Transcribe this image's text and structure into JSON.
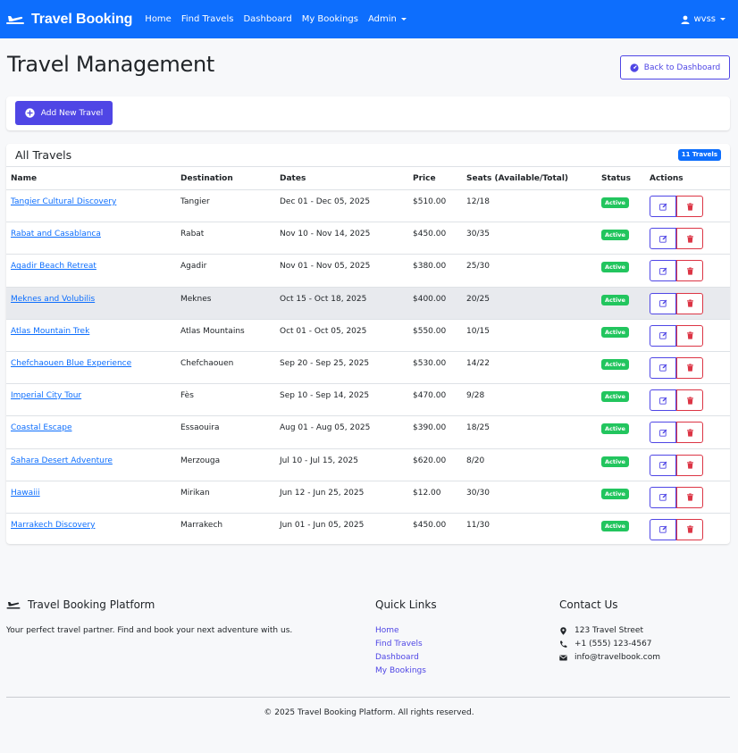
{
  "navbar": {
    "brand": "Travel Booking",
    "links": [
      "Home",
      "Find Travels",
      "Dashboard",
      "My Bookings"
    ],
    "admin_label": "Admin",
    "user": "wvss"
  },
  "header": {
    "title": "Travel Management",
    "back_label": "Back to Dashboard"
  },
  "actions": {
    "add_label": "Add New Travel"
  },
  "table": {
    "title": "All Travels",
    "count_badge": "11 Travels",
    "columns": [
      "Name",
      "Destination",
      "Dates",
      "Price",
      "Seats (Available/Total)",
      "Status",
      "Actions"
    ],
    "rows": [
      {
        "name": "Tangier Cultural Discovery",
        "destination": "Tangier",
        "dates": "Dec 01 - Dec 05, 2025",
        "price": "$510.00",
        "seats": "12/18",
        "status": "Active"
      },
      {
        "name": "Rabat and Casablanca",
        "destination": "Rabat",
        "dates": "Nov 10 - Nov 14, 2025",
        "price": "$450.00",
        "seats": "30/35",
        "status": "Active"
      },
      {
        "name": "Agadir Beach Retreat",
        "destination": "Agadir",
        "dates": "Nov 01 - Nov 05, 2025",
        "price": "$380.00",
        "seats": "25/30",
        "status": "Active"
      },
      {
        "name": "Meknes and Volubilis",
        "destination": "Meknes",
        "dates": "Oct 15 - Oct 18, 2025",
        "price": "$400.00",
        "seats": "20/25",
        "status": "Active"
      },
      {
        "name": "Atlas Mountain Trek",
        "destination": "Atlas Mountains",
        "dates": "Oct 01 - Oct 05, 2025",
        "price": "$550.00",
        "seats": "10/15",
        "status": "Active"
      },
      {
        "name": "Chefchaouen Blue Experience",
        "destination": "Chefchaouen",
        "dates": "Sep 20 - Sep 25, 2025",
        "price": "$530.00",
        "seats": "14/22",
        "status": "Active"
      },
      {
        "name": "Imperial City Tour",
        "destination": "Fès",
        "dates": "Sep 10 - Sep 14, 2025",
        "price": "$470.00",
        "seats": "9/28",
        "status": "Active"
      },
      {
        "name": "Coastal Escape",
        "destination": "Essaouira",
        "dates": "Aug 01 - Aug 05, 2025",
        "price": "$390.00",
        "seats": "18/25",
        "status": "Active"
      },
      {
        "name": "Sahara Desert Adventure",
        "destination": "Merzouga",
        "dates": "Jul 10 - Jul 15, 2025",
        "price": "$620.00",
        "seats": "8/20",
        "status": "Active"
      },
      {
        "name": "Hawaiii",
        "destination": "Mirikan",
        "dates": "Jun 12 - Jun 25, 2025",
        "price": "$12.00",
        "seats": "30/30",
        "status": "Active"
      },
      {
        "name": "Marrakech Discovery",
        "destination": "Marrakech",
        "dates": "Jun 01 - Jun 05, 2025",
        "price": "$450.00",
        "seats": "11/30",
        "status": "Active"
      }
    ]
  },
  "footer": {
    "brand": "Travel Booking Platform",
    "tagline": "Your perfect travel partner. Find and book your next adventure with us.",
    "quick_links_title": "Quick Links",
    "quick_links": [
      "Home",
      "Find Travels",
      "Dashboard",
      "My Bookings"
    ],
    "contact_title": "Contact Us",
    "address": "123 Travel Street",
    "phone": "+1 (555) 123-4567",
    "email": "info@travelbook.com",
    "copyright": "© 2025 Travel Booking Platform. All rights reserved."
  },
  "colors": {
    "navbar": "#0d6efd",
    "primary": "#4f46e5",
    "danger": "#dc3545",
    "success": "#22c55e",
    "link": "#0d6efd"
  }
}
